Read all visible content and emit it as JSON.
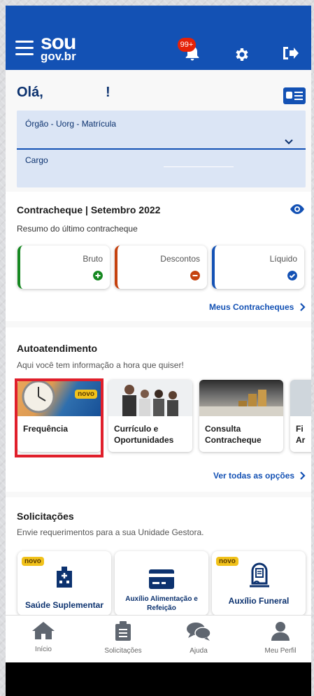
{
  "header": {
    "logo_top": "sou",
    "logo_bottom": "gov.br",
    "notification_count": "99+"
  },
  "greeting": {
    "hello": "Olá,",
    "punct": "!"
  },
  "profile_select": {
    "orgao_label": "Órgão - Uorg - Matrícula",
    "cargo_label": "Cargo"
  },
  "contracheque": {
    "title": "Contracheque | Setembro 2022",
    "subtitle": "Resumo do último contracheque",
    "cards": [
      {
        "label": "Bruto",
        "color": "#168821"
      },
      {
        "label": "Descontos",
        "color": "#c5420f"
      },
      {
        "label": "Líquido",
        "color": "#1351b4"
      }
    ],
    "link": "Meus Contracheques"
  },
  "autoatendimento": {
    "title": "Autoatendimento",
    "subtitle": "Aqui você tem informação a hora que quiser!",
    "cards": [
      {
        "label": "Frequência",
        "badge": "novo"
      },
      {
        "label_line1": "Currículo e",
        "label_line2": "Oportunidades"
      },
      {
        "label_line1": "Consulta",
        "label_line2": "Contracheque"
      },
      {
        "label_line1": "Fi",
        "label_line2": "Ar"
      }
    ],
    "link": "Ver todas as opções"
  },
  "solicitacoes": {
    "title": "Solicitações",
    "subtitle": "Envie requerimentos para a sua Unidade Gestora.",
    "cards": [
      {
        "label": "Saúde Suplementar",
        "badge": "novo"
      },
      {
        "label_line1": "Auxílio Alimentação e",
        "label_line2": "Refeição"
      },
      {
        "label": "Auxílio Funeral",
        "badge": "novo"
      }
    ]
  },
  "bottom_nav": {
    "items": [
      "Início",
      "Solicitações",
      "Ajuda",
      "Meu Perfil"
    ]
  },
  "colors": {
    "primary": "#1351b4",
    "dark_blue": "#0c326f",
    "badge_yellow": "#f1c21b",
    "highlight_red": "#e01f2b"
  }
}
